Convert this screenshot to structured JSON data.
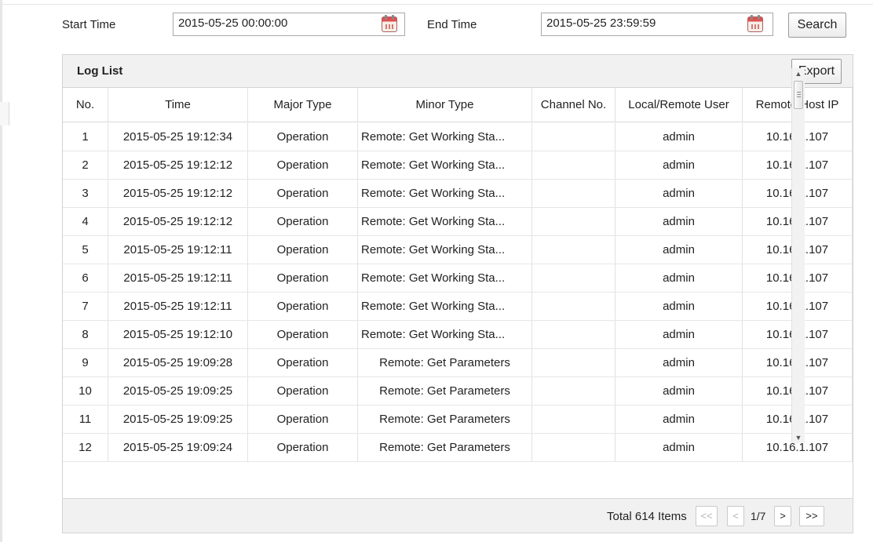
{
  "search": {
    "start_label": "Start Time",
    "start_value": "2015-05-25 00:00:00",
    "end_label": "End Time",
    "end_value": "2015-05-25 23:59:59",
    "search_button": "Search"
  },
  "log_panel": {
    "title": "Log List",
    "export_button": "Export",
    "columns": [
      "No.",
      "Time",
      "Major Type",
      "Minor Type",
      "Channel No.",
      "Local/Remote User",
      "Remote Host IP"
    ],
    "rows": [
      {
        "no": "1",
        "time": "2015-05-25 19:12:34",
        "major": "Operation",
        "minor": "Remote: Get Working Sta...",
        "channel": "",
        "user": "admin",
        "ip": "10.16.1.107"
      },
      {
        "no": "2",
        "time": "2015-05-25 19:12:12",
        "major": "Operation",
        "minor": "Remote: Get Working Sta...",
        "channel": "",
        "user": "admin",
        "ip": "10.16.1.107"
      },
      {
        "no": "3",
        "time": "2015-05-25 19:12:12",
        "major": "Operation",
        "minor": "Remote: Get Working Sta...",
        "channel": "",
        "user": "admin",
        "ip": "10.16.1.107"
      },
      {
        "no": "4",
        "time": "2015-05-25 19:12:12",
        "major": "Operation",
        "minor": "Remote: Get Working Sta...",
        "channel": "",
        "user": "admin",
        "ip": "10.16.1.107"
      },
      {
        "no": "5",
        "time": "2015-05-25 19:12:11",
        "major": "Operation",
        "minor": "Remote: Get Working Sta...",
        "channel": "",
        "user": "admin",
        "ip": "10.16.1.107"
      },
      {
        "no": "6",
        "time": "2015-05-25 19:12:11",
        "major": "Operation",
        "minor": "Remote: Get Working Sta...",
        "channel": "",
        "user": "admin",
        "ip": "10.16.1.107"
      },
      {
        "no": "7",
        "time": "2015-05-25 19:12:11",
        "major": "Operation",
        "minor": "Remote: Get Working Sta...",
        "channel": "",
        "user": "admin",
        "ip": "10.16.1.107"
      },
      {
        "no": "8",
        "time": "2015-05-25 19:12:10",
        "major": "Operation",
        "minor": "Remote: Get Working Sta...",
        "channel": "",
        "user": "admin",
        "ip": "10.16.1.107"
      },
      {
        "no": "9",
        "time": "2015-05-25 19:09:28",
        "major": "Operation",
        "minor": "Remote: Get Parameters",
        "channel": "",
        "user": "admin",
        "ip": "10.16.1.107"
      },
      {
        "no": "10",
        "time": "2015-05-25 19:09:25",
        "major": "Operation",
        "minor": "Remote: Get Parameters",
        "channel": "",
        "user": "admin",
        "ip": "10.16.1.107"
      },
      {
        "no": "11",
        "time": "2015-05-25 19:09:25",
        "major": "Operation",
        "minor": "Remote: Get Parameters",
        "channel": "",
        "user": "admin",
        "ip": "10.16.1.107"
      },
      {
        "no": "12",
        "time": "2015-05-25 19:09:24",
        "major": "Operation",
        "minor": "Remote: Get Parameters",
        "channel": "",
        "user": "admin",
        "ip": "10.16.1.107"
      }
    ]
  },
  "pagination": {
    "total": "Total 614 Items",
    "first": "<<",
    "prev": "<",
    "page": "1/7",
    "next": ">",
    "last": ">>"
  },
  "icons": {
    "calendar": "calendar-icon",
    "scroll_up": "▲",
    "scroll_down": "▼"
  },
  "colors": {
    "header_bg": "#f1f1f1",
    "border": "#d2d2d2",
    "button_border": "#9a9a9a"
  }
}
